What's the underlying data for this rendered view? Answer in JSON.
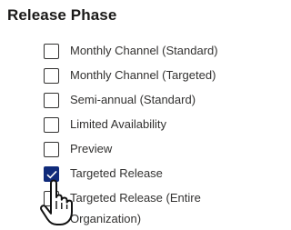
{
  "section": {
    "title": "Release Phase"
  },
  "options": [
    {
      "label": "Monthly Channel (Standard)",
      "checked": false
    },
    {
      "label": "Monthly Channel (Targeted)",
      "checked": false
    },
    {
      "label": "Semi-annual (Standard)",
      "checked": false
    },
    {
      "label": "Limited Availability",
      "checked": false
    },
    {
      "label": "Preview",
      "checked": false
    },
    {
      "label": "Targeted Release",
      "checked": true
    },
    {
      "label": "Targeted Release (Entire Organization)",
      "checked": false
    }
  ],
  "colors": {
    "checked_fill": "#0f2a7a",
    "text": "#323130"
  },
  "cursor": {
    "icon": "hand-pointer-icon"
  }
}
